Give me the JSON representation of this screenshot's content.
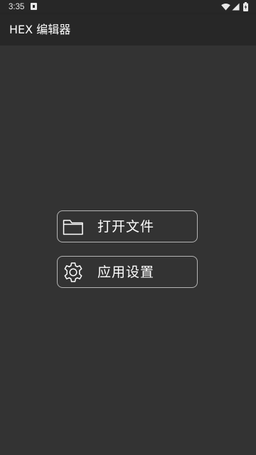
{
  "status_bar": {
    "time": "3:35",
    "icons": [
      "notification-icon",
      "wifi-icon",
      "signal-icon",
      "battery-icon"
    ]
  },
  "app_bar": {
    "title": "HEX 编辑器"
  },
  "actions": {
    "open_file": {
      "label": "打开文件",
      "icon": "folder-icon"
    },
    "app_settings": {
      "label": "应用设置",
      "icon": "gear-icon"
    }
  },
  "colors": {
    "background": "#333333",
    "app_bar": "#272727",
    "button_border": "#b4b4b4",
    "text": "#ffffff"
  }
}
